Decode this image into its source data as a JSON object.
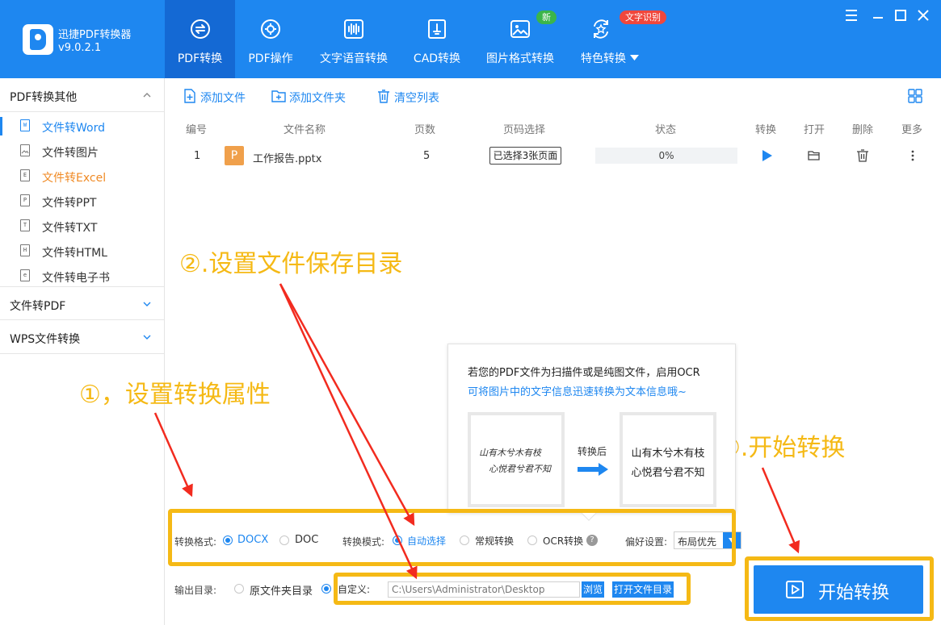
{
  "app": {
    "name": "迅捷PDF转换器",
    "version": "v9.0.2.1"
  },
  "nav": {
    "tabs": [
      {
        "label": "PDF转换",
        "icon": "swap-circle-icon"
      },
      {
        "label": "PDF操作",
        "icon": "gear-circle-icon"
      },
      {
        "label": "文字语音转换",
        "icon": "audio-wave-icon"
      },
      {
        "label": "CAD转换",
        "icon": "cad-icon"
      },
      {
        "label": "图片格式转换",
        "icon": "image-icon"
      },
      {
        "label": "特色转换",
        "icon": "feature-convert-icon"
      }
    ],
    "badge_new": "新",
    "badge_ocr": "文字识别"
  },
  "sidebar": {
    "group1": "PDF转换其他",
    "items": [
      {
        "label": "文件转Word",
        "icon": "W"
      },
      {
        "label": "文件转图片",
        "icon": "img"
      },
      {
        "label": "文件转Excel",
        "icon": "E"
      },
      {
        "label": "文件转PPT",
        "icon": "P"
      },
      {
        "label": "文件转TXT",
        "icon": "T"
      },
      {
        "label": "文件转HTML",
        "icon": "H"
      },
      {
        "label": "文件转电子书",
        "icon": "e"
      }
    ],
    "group2": "文件转PDF",
    "group3": "WPS文件转换"
  },
  "toolbar": {
    "add_file": "添加文件",
    "add_folder": "添加文件夹",
    "clear_list": "清空列表"
  },
  "table": {
    "headers": {
      "num": "编号",
      "name": "文件名称",
      "pages": "页数",
      "page_select": "页码选择",
      "status": "状态",
      "convert": "转换",
      "open": "打开",
      "delete": "删除",
      "more": "更多"
    },
    "rows": [
      {
        "num": "1",
        "file_type": "P",
        "name": "工作报告.pptx",
        "pages": "5",
        "page_select": "已选择3张页面",
        "progress": "0%"
      }
    ]
  },
  "annotations": {
    "step1": "①，设置转换属性",
    "step2": "②.设置文件保存目录",
    "step3": "③.开始转换",
    "color": "#f5b915"
  },
  "ocr_tip": {
    "line1": "若您的PDF文件为扫描件或是纯图文件，启用OCR",
    "line2": "可将图片中的文字信息迅速转换为文本信息哦~",
    "hand_line1": "山有木兮木有枝",
    "hand_line2": "心悦君兮君不知",
    "after_label": "转换后",
    "text_line1": "山有木兮木有枝",
    "text_line2": "心悦君兮君不知"
  },
  "settings": {
    "format_label": "转换格式:",
    "format_docx": "DOCX",
    "format_doc": "DOC",
    "mode_label": "转换模式:",
    "mode_auto": "自动选择",
    "mode_normal": "常规转换",
    "mode_ocr": "OCR转换",
    "pref_label": "偏好设置:",
    "pref_value": "布局优先",
    "output_label": "输出目录:",
    "output_original": "原文件夹目录",
    "output_custom": "自定义:",
    "output_path": "C:\\Users\\Administrator\\Desktop",
    "browse": "浏览",
    "open_folder": "打开文件目录"
  },
  "start_button": "开始转换",
  "colors": {
    "primary": "#1e87f0",
    "active_tab": "#1469d4",
    "orange_text": "#f08a24"
  }
}
